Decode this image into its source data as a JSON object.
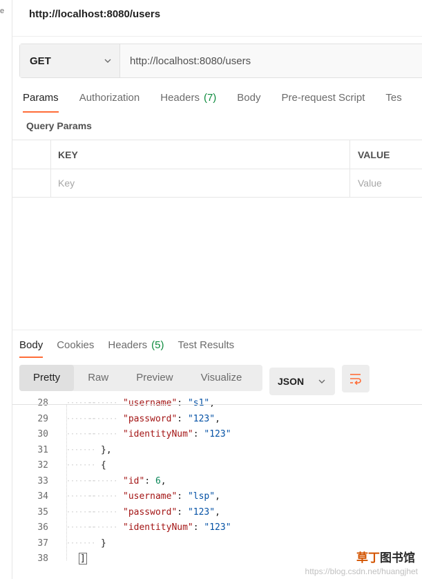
{
  "sidebar": {
    "mark": "e"
  },
  "request": {
    "title": "http://localhost:8080/users",
    "method": "GET",
    "url": "http://localhost:8080/users"
  },
  "request_tabs": [
    {
      "label": "Params",
      "count": "",
      "active": true
    },
    {
      "label": "Authorization",
      "count": ""
    },
    {
      "label": "Headers",
      "count": "(7)"
    },
    {
      "label": "Body",
      "count": ""
    },
    {
      "label": "Pre-request Script",
      "count": ""
    },
    {
      "label": "Tes",
      "count": ""
    }
  ],
  "query_params": {
    "title": "Query Params",
    "key_header": "KEY",
    "value_header": "VALUE",
    "key_placeholder": "Key",
    "value_placeholder": "Value"
  },
  "response_tabs": [
    {
      "label": "Body",
      "count": "",
      "active": true
    },
    {
      "label": "Cookies",
      "count": ""
    },
    {
      "label": "Headers",
      "count": "(5)"
    },
    {
      "label": "Test Results",
      "count": ""
    }
  ],
  "view_modes": [
    "Pretty",
    "Raw",
    "Preview",
    "Visualize"
  ],
  "format": "JSON",
  "code_lines": [
    {
      "n": "28",
      "indent": 2,
      "key": "\"username\"",
      "sep": ": ",
      "val": "\"s1\"",
      "vtype": "str",
      "tail": ","
    },
    {
      "n": "29",
      "indent": 2,
      "key": "\"password\"",
      "sep": ": ",
      "val": "\"123\"",
      "vtype": "str",
      "tail": ","
    },
    {
      "n": "30",
      "indent": 2,
      "key": "\"identityNum\"",
      "sep": ": ",
      "val": "\"123\"",
      "vtype": "str",
      "tail": ""
    },
    {
      "n": "31",
      "indent": 1,
      "key": "",
      "sep": "",
      "val": "",
      "vtype": "",
      "tail": "},"
    },
    {
      "n": "32",
      "indent": 1,
      "key": "",
      "sep": "",
      "val": "",
      "vtype": "",
      "tail": "{"
    },
    {
      "n": "33",
      "indent": 2,
      "key": "\"id\"",
      "sep": ": ",
      "val": "6",
      "vtype": "num",
      "tail": ","
    },
    {
      "n": "34",
      "indent": 2,
      "key": "\"username\"",
      "sep": ": ",
      "val": "\"lsp\"",
      "vtype": "str",
      "tail": ","
    },
    {
      "n": "35",
      "indent": 2,
      "key": "\"password\"",
      "sep": ": ",
      "val": "\"123\"",
      "vtype": "str",
      "tail": ","
    },
    {
      "n": "36",
      "indent": 2,
      "key": "\"identityNum\"",
      "sep": ": ",
      "val": "\"123\"",
      "vtype": "str",
      "tail": ""
    },
    {
      "n": "37",
      "indent": 1,
      "key": "",
      "sep": "",
      "val": "",
      "vtype": "",
      "tail": "}"
    },
    {
      "n": "38",
      "indent": 0,
      "key": "",
      "sep": "",
      "val": "",
      "vtype": "",
      "tail": "]"
    }
  ],
  "watermark": {
    "logo_a": "草丁",
    "logo_b": "图书馆",
    "url": "https://blog.csdn.net/huangjhet"
  },
  "colors": {
    "accent": "#ff6c37",
    "count_green": "#0c8a3c",
    "json_key": "#a31515",
    "json_string": "#0451a5",
    "json_number": "#098658"
  }
}
